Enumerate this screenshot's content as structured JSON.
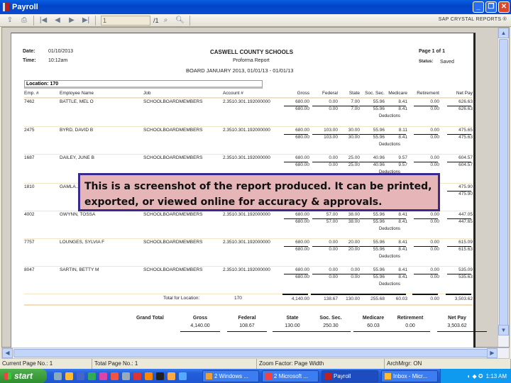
{
  "window": {
    "title": "Payroll",
    "brand": "SAP CRYSTAL REPORTS ®",
    "minimize_label": "_",
    "restore_label": "❐",
    "close_label": "✕"
  },
  "toolbar": {
    "page_input_value": "1",
    "page_count_label": "/1"
  },
  "report": {
    "date_label": "Date:",
    "date_value": "01/10/2013",
    "time_label": "Time:",
    "time_value": "10:12am",
    "org": "CASWELL COUNTY SCHOOLS",
    "report_title": "Proforma Report",
    "subtitle": "BOARD   JANUARY 2013, 01/01/13 - 01/01/13",
    "page_label": "Page 1 of 1",
    "status_label": "Status:",
    "status_value": "Saved",
    "location_label": "Location: 170",
    "columns": [
      "Emp. #",
      "Employee Name",
      "Job",
      "Account #",
      "Gross",
      "Federal",
      "State",
      "Soc. Sec.",
      "Medicare",
      "Retirement",
      "Net Pay"
    ],
    "deductions_label": "Deductions",
    "rows": [
      {
        "emp": "7462",
        "name": "BATTLE, MEL O",
        "job": "SCHOOLBOARDMEMBERS",
        "account": "2.3510.301.192000000",
        "line1": [
          "680.00",
          "0.00",
          "7.00",
          "55.96",
          "8.41",
          "0.00",
          "626.63"
        ],
        "line2": [
          "680.00",
          "0.00",
          "7.00",
          "55.96",
          "8.41",
          "0.00",
          "626.63"
        ]
      },
      {
        "emp": "2475",
        "name": "BYRD, DAVID B",
        "job": "SCHOOLBOARDMEMBERS",
        "account": "2.3510.301.192000000",
        "line1": [
          "680.00",
          "103.00",
          "30.00",
          "55.96",
          "8.11",
          "0.00",
          "475.65"
        ],
        "line2": [
          "680.00",
          "103.00",
          "30.00",
          "55.96",
          "8.41",
          "0.00",
          "475.63"
        ]
      },
      {
        "emp": "1687",
        "name": "DAILEY, JUNE B",
        "job": "SCHOOLBOARDMEMBERS",
        "account": "2.3510.301.192000000",
        "line1": [
          "680.00",
          "0.00",
          "25.00",
          "40.96",
          "9.57",
          "0.00",
          "604.57"
        ],
        "line2": [
          "680.00",
          "0.00",
          "25.00",
          "40.96",
          "9.57",
          "0.00",
          "604.57"
        ]
      },
      {
        "emp": "1810",
        "name": "GAMLA...",
        "job": "",
        "account": "",
        "line1": [
          "",
          "",
          "",
          "",
          "",
          "0.00",
          "475.90"
        ],
        "line2": [
          "",
          "",
          "",
          "",
          "",
          "0.00",
          "475.90"
        ]
      },
      {
        "emp": "4002",
        "name": "GWYNN, TOSSA",
        "job": "SCHOOLBOARDMEMBERS",
        "account": "2.3510.301.192000000",
        "line1": [
          "680.00",
          "57.00",
          "38.00",
          "55.96",
          "8.41",
          "0.00",
          "447.05"
        ],
        "line2": [
          "680.00",
          "57.00",
          "38.00",
          "55.96",
          "8.41",
          "0.00",
          "447.65"
        ]
      },
      {
        "emp": "7757",
        "name": "LOUNGES, SYLVIA F",
        "job": "SCHOOLBOARDMEMBERS",
        "account": "2.3510.301.192000000",
        "line1": [
          "680.00",
          "0.00",
          "20.00",
          "55.96",
          "8.41",
          "0.00",
          "615.09"
        ],
        "line2": [
          "680.00",
          "0.00",
          "20.00",
          "55.96",
          "8.41",
          "0.00",
          "615.63"
        ]
      },
      {
        "emp": "8047",
        "name": "SARTIN, BETTY M",
        "job": "SCHOOLBOARDMEMBERS",
        "account": "2.3510.301.192000000",
        "line1": [
          "680.00",
          "0.00",
          "0.00",
          "55.96",
          "8.41",
          "0.00",
          "535.09"
        ],
        "line2": [
          "680.00",
          "0.00",
          "0.00",
          "55.96",
          "8.41",
          "0.00",
          "535.63"
        ]
      }
    ],
    "location_total_label": "Total for Location:",
    "location_total_id": "170",
    "location_totals": [
      "4,140.00",
      "138.67",
      "130.00",
      "255.68",
      "60.03",
      "0.00",
      "3,503.62"
    ],
    "grand_total_label": "Grand Total",
    "grand_headers": [
      "Gross",
      "Federal",
      "State",
      "Soc. Sec.",
      "Medicare",
      "Retirement",
      "Net Pay"
    ],
    "grand_values": [
      "4,140.00",
      "108.67",
      "130.00",
      "250.30",
      "60.03",
      "0.00",
      "3,503.62"
    ]
  },
  "callout": {
    "text": "This is a screenshot of the report produced.  It can be printed, exported, or viewed online for accuracy & approvals."
  },
  "statusbar": {
    "current_page": "Current Page No.: 1",
    "total_page": "Total Page No.: 1",
    "zoom": "Zoom Factor: Page Width",
    "archive": "ArchMrgr: ON"
  },
  "taskbar": {
    "start_label": "start",
    "tasks": [
      {
        "label": "2 Windows ..."
      },
      {
        "label": "2 Microsoft ..."
      },
      {
        "label": "Payroll"
      },
      {
        "label": "Inbox - Micr..."
      }
    ],
    "clock": "1:13 AM"
  }
}
